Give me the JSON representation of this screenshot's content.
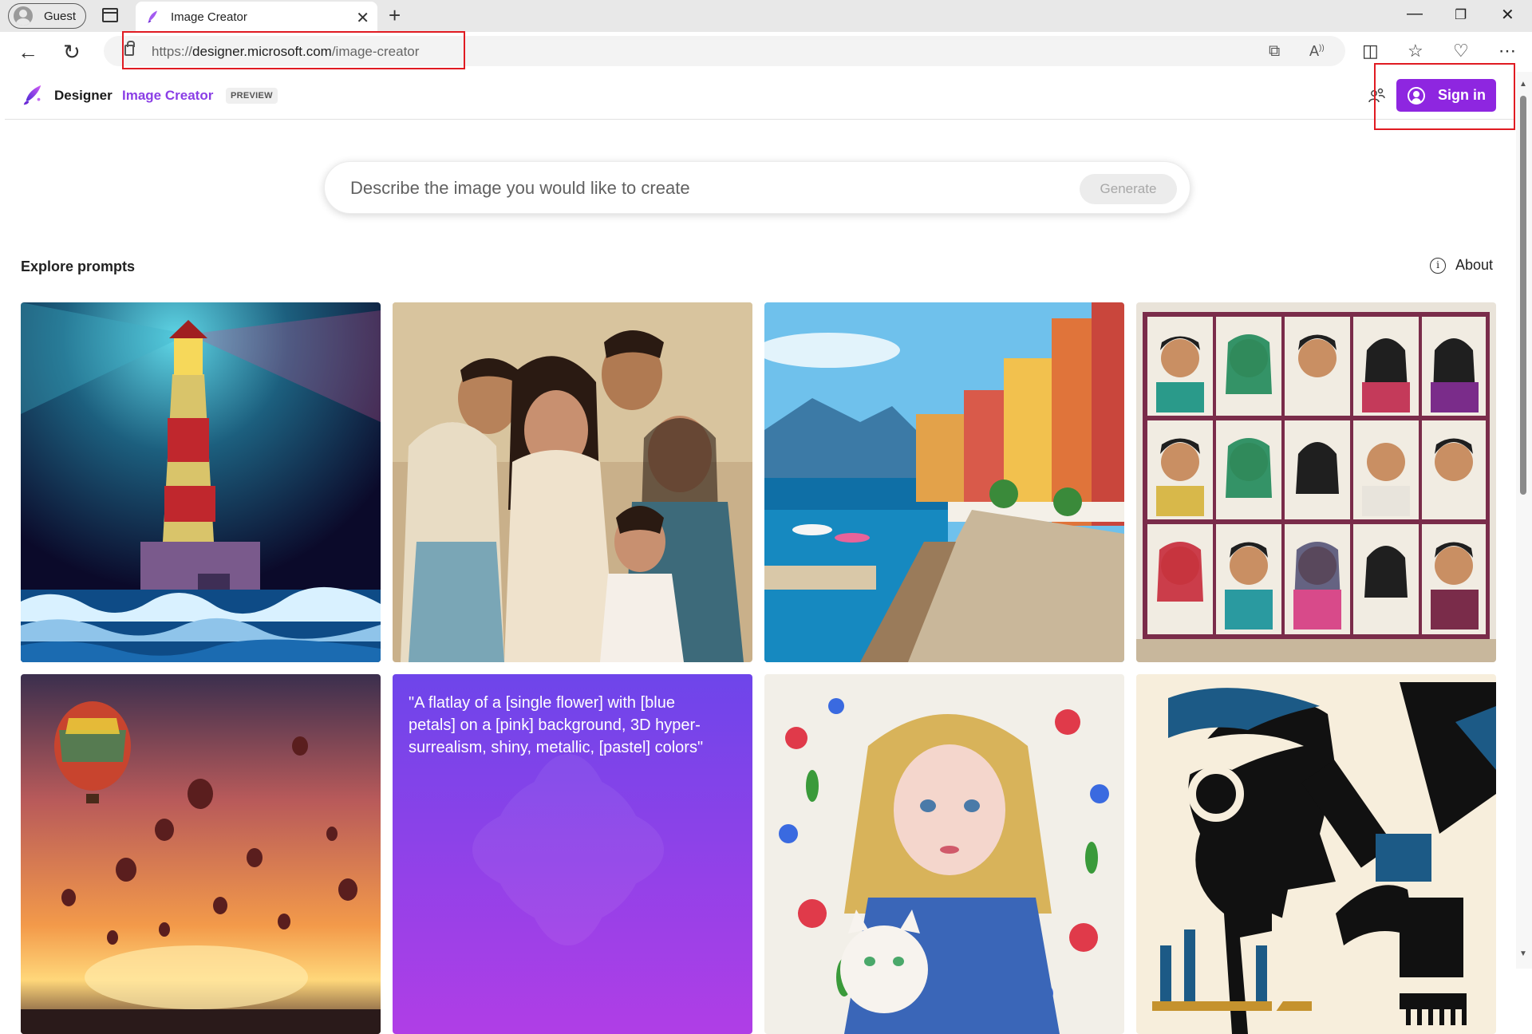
{
  "browser": {
    "guest_label": "Guest",
    "tab_title": "Image Creator",
    "url_scheme": "https://",
    "url_domain": "designer.microsoft.com",
    "url_path": "/image-creator"
  },
  "header": {
    "brand": "Designer",
    "product": "Image Creator",
    "badge": "PREVIEW",
    "signin_label": "Sign in"
  },
  "prompt": {
    "placeholder": "Describe the image you would like to create",
    "generate_label": "Generate"
  },
  "explore": {
    "title": "Explore prompts",
    "about_label": "About"
  },
  "cards": [
    {
      "subject": "lighthouse-at-night"
    },
    {
      "subject": "family-portrait"
    },
    {
      "subject": "lakeside-village"
    },
    {
      "subject": "cross-stitch-portraits"
    },
    {
      "subject": "hot-air-balloons-sunset"
    },
    {
      "subject": "prompt-text",
      "text": "\"A flatlay of a [single flower] with [blue petals] on a [pink] background, 3D hyper-surrealism, shiny, metallic, [pastel] colors\""
    },
    {
      "subject": "embroidered-girl-with-cat"
    },
    {
      "subject": "scientist-with-microscope"
    }
  ],
  "colors": {
    "accent": "#8e26e0",
    "product_text": "#8a3ee6",
    "highlight_box": "#e01b22"
  }
}
